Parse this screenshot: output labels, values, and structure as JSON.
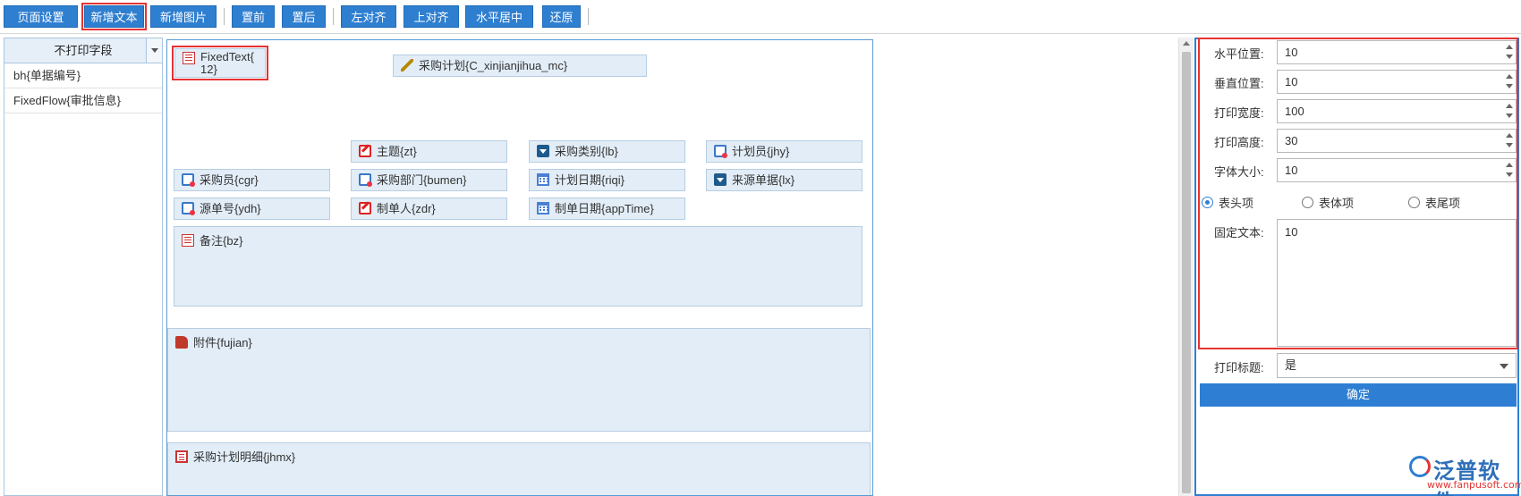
{
  "toolbar": {
    "buttons": [
      {
        "label": "页面设置"
      },
      {
        "label": "新增文本",
        "active": true
      },
      {
        "label": "新增图片"
      },
      {
        "label": "置前"
      },
      {
        "label": "置后"
      },
      {
        "label": "左对齐"
      },
      {
        "label": "上对齐"
      },
      {
        "label": "水平居中"
      },
      {
        "label": "还原"
      }
    ]
  },
  "left_panel": {
    "header": "不打印字段",
    "items": [
      "bh{单据编号}",
      "FixedFlow{审批信息}"
    ]
  },
  "canvas": {
    "fixed_text": "FixedText{ 12}",
    "fields": {
      "plan_name": "采购计划{C_xinjianjihua_mc}",
      "subject": "主题{zt}",
      "category": "采购类别{lb}",
      "planner": "计划员{jhy}",
      "buyer": "采购员{cgr}",
      "dept": "采购部门{bumen}",
      "plan_date": "计划日期{riqi}",
      "source": "来源单据{lx}",
      "source_no": "源单号{ydh}",
      "creator": "制单人{zdr}",
      "create_date": "制单日期{appTime}",
      "remark": "备注{bz}",
      "attachment": "附件{fujian}",
      "detail": "采购计划明细{jhmx}"
    }
  },
  "properties": {
    "h_pos": {
      "label": "水平位置:",
      "value": "10"
    },
    "v_pos": {
      "label": "垂直位置:",
      "value": "10"
    },
    "width": {
      "label": "打印宽度:",
      "value": "100"
    },
    "height": {
      "label": "打印高度:",
      "value": "30"
    },
    "font_size": {
      "label": "字体大小:",
      "value": "10"
    },
    "section": {
      "header": "表头项",
      "body": "表体项",
      "footer": "表尾项",
      "selected": "header"
    },
    "fixed_text": {
      "label": "固定文本:",
      "value": "10"
    },
    "print_title": {
      "label": "打印标题:",
      "value": "是"
    },
    "confirm": "确定"
  },
  "logo": {
    "name": "泛普软件",
    "url": "www.fanpusoft.com"
  }
}
